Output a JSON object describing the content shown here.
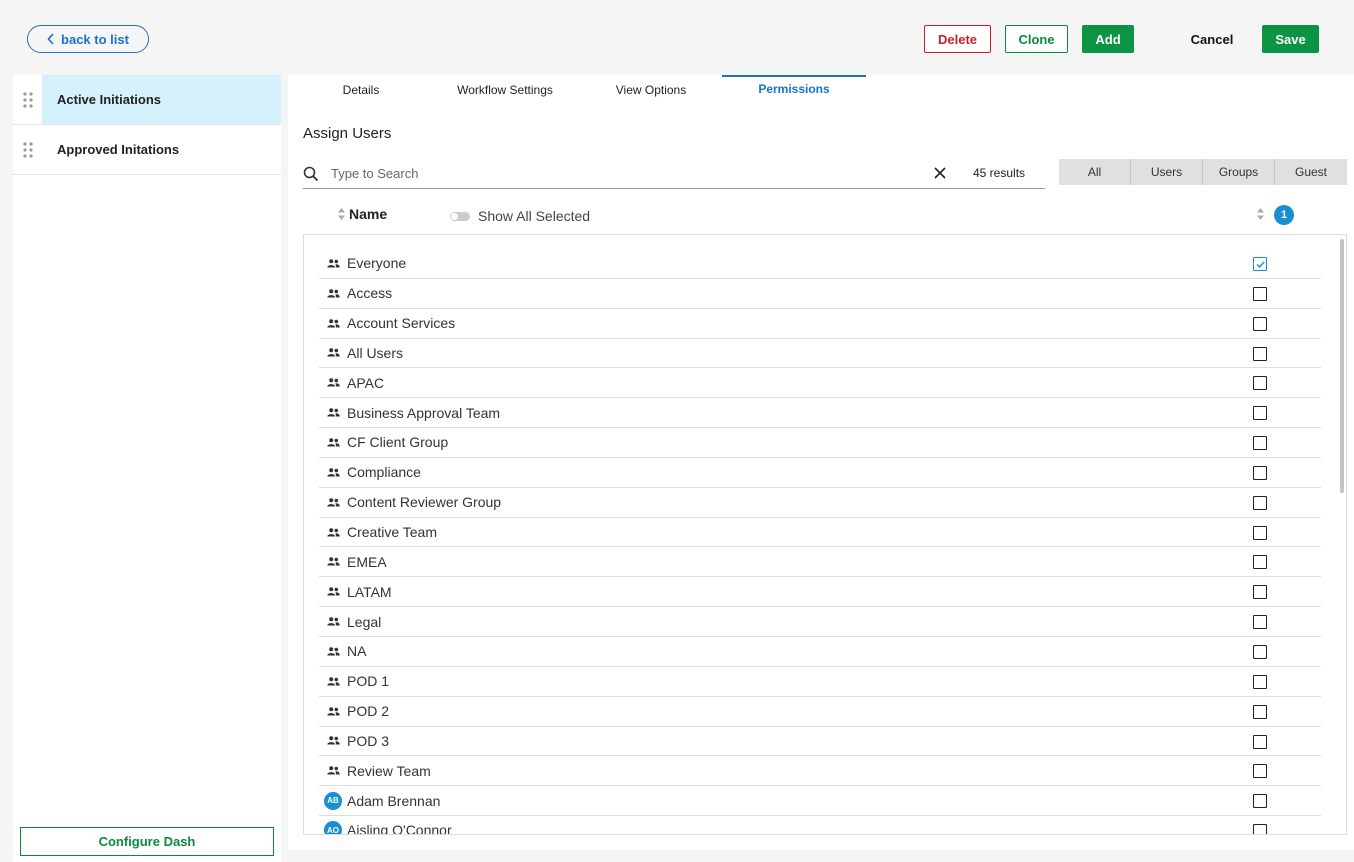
{
  "toolbar": {
    "back_label": "back to list",
    "delete_label": "Delete",
    "clone_label": "Clone",
    "add_label": "Add",
    "cancel_label": "Cancel",
    "save_label": "Save"
  },
  "sidebar": {
    "items": [
      {
        "label": "Active Initiations",
        "active": true
      },
      {
        "label": "Approved Initations",
        "active": false
      }
    ],
    "configure_label": "Configure Dash"
  },
  "tabs": [
    {
      "label": "Details"
    },
    {
      "label": "Workflow Settings"
    },
    {
      "label": "View Options"
    },
    {
      "label": "Permissions",
      "active": true
    }
  ],
  "assign": {
    "title": "Assign Users",
    "search_placeholder": "Type to Search",
    "search_value": "",
    "results": "45 results",
    "filters": [
      "All",
      "Users",
      "Groups",
      "Guest"
    ],
    "name_header": "Name",
    "show_selected_label": "Show All Selected",
    "selected_count": "1"
  },
  "rows": [
    {
      "name": "Everyone",
      "type": "group",
      "checked": true
    },
    {
      "name": "Access",
      "type": "group",
      "checked": false
    },
    {
      "name": "Account Services",
      "type": "group",
      "checked": false
    },
    {
      "name": "All Users",
      "type": "group",
      "checked": false
    },
    {
      "name": "APAC",
      "type": "group",
      "checked": false
    },
    {
      "name": "Business Approval Team",
      "type": "group",
      "checked": false
    },
    {
      "name": "CF Client Group",
      "type": "group",
      "checked": false
    },
    {
      "name": "Compliance",
      "type": "group",
      "checked": false
    },
    {
      "name": "Content Reviewer Group",
      "type": "group",
      "checked": false
    },
    {
      "name": "Creative Team",
      "type": "group",
      "checked": false
    },
    {
      "name": "EMEA",
      "type": "group",
      "checked": false
    },
    {
      "name": "LATAM",
      "type": "group",
      "checked": false
    },
    {
      "name": "Legal",
      "type": "group",
      "checked": false
    },
    {
      "name": "NA",
      "type": "group",
      "checked": false
    },
    {
      "name": "POD 1",
      "type": "group",
      "checked": false
    },
    {
      "name": "POD 2",
      "type": "group",
      "checked": false
    },
    {
      "name": "POD 3",
      "type": "group",
      "checked": false
    },
    {
      "name": "Review Team",
      "type": "group",
      "checked": false
    },
    {
      "name": "Adam Brennan",
      "type": "user",
      "initials": "AB",
      "checked": false
    },
    {
      "name": "Aisling O'Connor",
      "type": "user",
      "initials": "AO",
      "checked": false
    }
  ],
  "colors": {
    "accent": "#1a73c9",
    "primary_green": "#0b9444",
    "danger": "#c8202a",
    "active_row": "#d5f1fb"
  }
}
